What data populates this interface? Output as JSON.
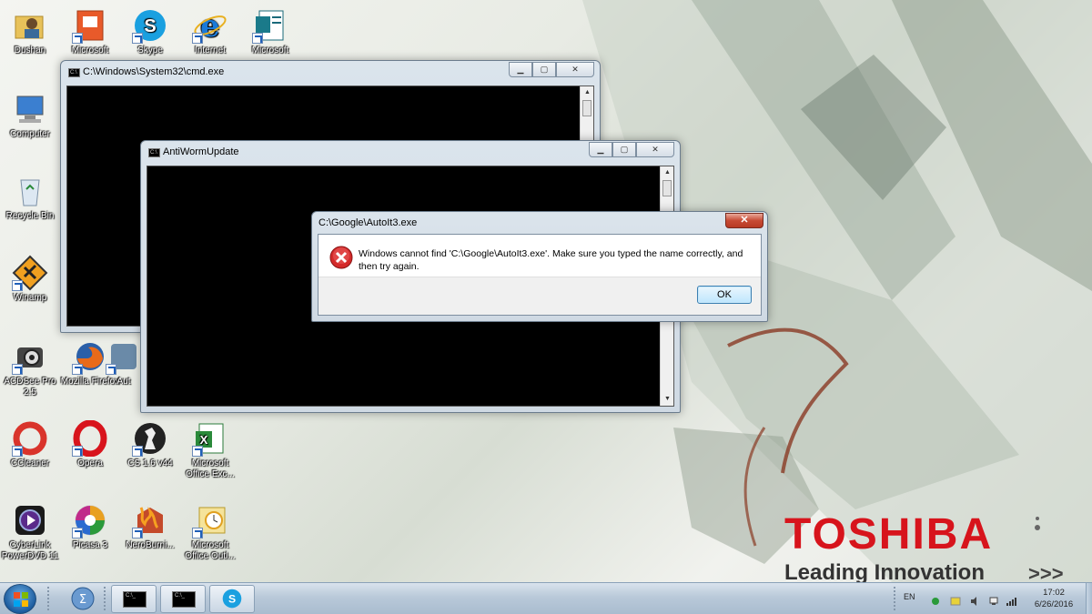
{
  "desktop_icons": [
    {
      "label": "Dushan",
      "icon": "user-folder-icon"
    },
    {
      "label": "Microsoft",
      "icon": "powerpoint-icon"
    },
    {
      "label": "Skype",
      "icon": "skype-icon"
    },
    {
      "label": "Internet",
      "icon": "internet-explorer-icon"
    },
    {
      "label": "Microsoft",
      "icon": "publisher-icon"
    },
    {
      "label": "Computer",
      "icon": "computer-icon"
    },
    {
      "label": "Recycle Bin",
      "icon": "recycle-bin-icon"
    },
    {
      "label": "Winamp",
      "icon": "winamp-icon"
    },
    {
      "label": "ACDSee Pro 2.5",
      "icon": "acdsee-icon"
    },
    {
      "label": "Mozilla Firefox",
      "icon": "firefox-icon"
    },
    {
      "label": "Aut",
      "icon": "autoit-icon"
    },
    {
      "label": "CCleaner",
      "icon": "ccleaner-icon"
    },
    {
      "label": "Opera",
      "icon": "opera-icon"
    },
    {
      "label": "CS 1.6 v44",
      "icon": "counter-strike-icon"
    },
    {
      "label": "Microsoft Office Exc...",
      "icon": "excel-icon"
    },
    {
      "label": "CyberLink PowerDVD 11",
      "icon": "powerdvd-icon"
    },
    {
      "label": "Picasa 3",
      "icon": "picasa-icon"
    },
    {
      "label": "NeroBurni...",
      "icon": "nero-icon"
    },
    {
      "label": "Microsoft Office Outl...",
      "icon": "outlook-icon"
    }
  ],
  "windows": {
    "cmd": {
      "title": "C:\\Windows\\System32\\cmd.exe"
    },
    "antiworm": {
      "title": "AntiWormUpdate"
    }
  },
  "dialog": {
    "title": "C:\\Google\\AutoIt3.exe",
    "message": "Windows cannot find 'C:\\Google\\AutoIt3.exe'. Make sure you typed the name correctly, and then try again.",
    "ok_label": "OK",
    "close_label": "✕",
    "icon": "error-icon"
  },
  "wallpaper": {
    "brand": "TOSHIBA",
    "tagline": "Leading Innovation",
    "chevrons": ">>>",
    "brand_color": "#d7141c"
  },
  "taskbar": {
    "items": [
      {
        "icon": "sigma-icon"
      },
      {
        "icon": "cmd-icon",
        "text": "C:\\_"
      },
      {
        "icon": "cmd-icon",
        "text": "C:\\_"
      },
      {
        "icon": "skype-icon"
      }
    ],
    "tray": {
      "language": "EN",
      "time": "17:02",
      "date": "6/26/2016"
    }
  }
}
